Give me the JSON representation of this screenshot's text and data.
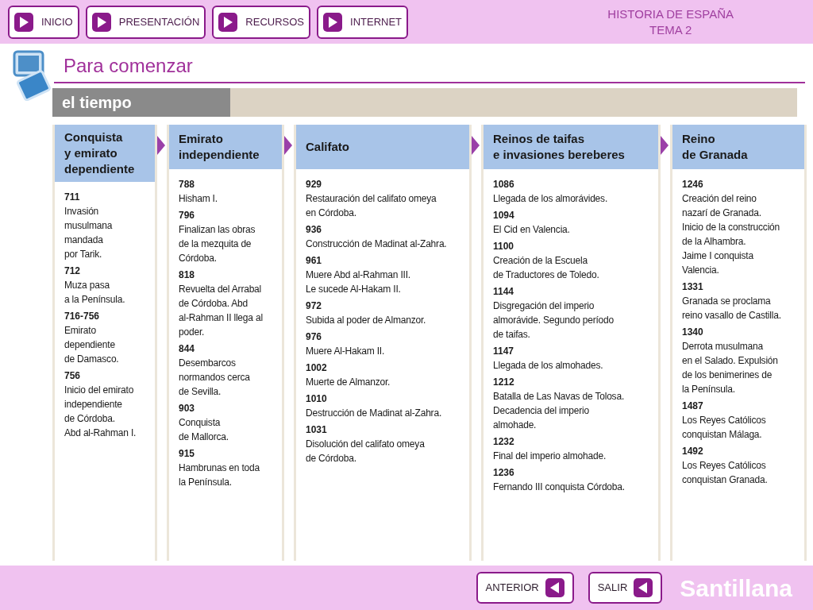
{
  "nav": [
    {
      "label": "INICIO"
    },
    {
      "label": "PRESENTACIÓN"
    },
    {
      "label": "RECURSOS"
    },
    {
      "label": "INTERNET"
    }
  ],
  "course": {
    "subject": "HISTORIA DE ESPAÑA",
    "unit": "TEMA 2"
  },
  "title": "Para comenzar",
  "section": "el tiempo",
  "columns": [
    {
      "title": "Conquista\ny emirato\ndependiente",
      "entries": [
        {
          "year": "711",
          "text": "Invasión\nmusulmana\nmandada\npor Tarik."
        },
        {
          "year": "712",
          "text": "Muza pasa\na la Península."
        },
        {
          "year": "716-756",
          "text": "Emirato\ndependiente\nde Damasco."
        },
        {
          "year": "756",
          "text": "Inicio del emirato\nindependiente\nde Córdoba.\nAbd al-Rahman I."
        }
      ]
    },
    {
      "title": "Emirato\nindependiente",
      "entries": [
        {
          "year": "788",
          "text": "Hisham I."
        },
        {
          "year": "796",
          "text": "Finalizan las obras\nde la mezquita de\nCórdoba."
        },
        {
          "year": "818",
          "text": "Revuelta del Arrabal\nde Córdoba. Abd\nal-Rahman II llega al\npoder."
        },
        {
          "year": "844",
          "text": "Desembarcos\nnormandos cerca\nde Sevilla."
        },
        {
          "year": "903",
          "text": "Conquista\nde Mallorca."
        },
        {
          "year": "915",
          "text": "Hambrunas en toda\nla Península."
        }
      ]
    },
    {
      "title": "Califato",
      "entries": [
        {
          "year": "929",
          "text": "Restauración del califato omeya\nen Córdoba."
        },
        {
          "year": "936",
          "text": "Construcción de Madinat al-Zahra."
        },
        {
          "year": "961",
          "text": "Muere Abd al-Rahman III.\nLe sucede Al-Hakam II."
        },
        {
          "year": "972",
          "text": "Subida al poder de Almanzor."
        },
        {
          "year": "976",
          "text": "Muere Al-Hakam II."
        },
        {
          "year": "1002",
          "text": "Muerte de Almanzor."
        },
        {
          "year": "1010",
          "text": "Destrucción de Madinat al-Zahra."
        },
        {
          "year": "1031",
          "text": "Disolución del califato omeya\nde Córdoba."
        }
      ]
    },
    {
      "title": "Reinos de taifas\ne invasiones bereberes",
      "entries": [
        {
          "year": "1086",
          "text": "Llegada de los almorávides."
        },
        {
          "year": "1094",
          "text": "El Cid en Valencia."
        },
        {
          "year": "1100",
          "text": "Creación de la Escuela\nde Traductores de Toledo."
        },
        {
          "year": "1144",
          "text": "Disgregación del imperio\nalmorávide. Segundo período\nde taifas."
        },
        {
          "year": "1147",
          "text": "Llegada de los almohades."
        },
        {
          "year": "1212",
          "text": "Batalla de Las Navas de Tolosa.\nDecadencia del imperio\nalmohade."
        },
        {
          "year": "1232",
          "text": "Final del imperio almohade."
        },
        {
          "year": "1236",
          "text": "Fernando III conquista Córdoba."
        }
      ]
    },
    {
      "title": "Reino\nde Granada",
      "entries": [
        {
          "year": "1246",
          "text": "Creación del reino\nnazarí de Granada.\nInicio de la construcción\nde la Alhambra.\nJaime I conquista\nValencia."
        },
        {
          "year": "1331",
          "text": "Granada se proclama\nreino vasallo de Castilla."
        },
        {
          "year": "1340",
          "text": "Derrota musulmana\nen el Salado. Expulsión\nde los benimerines de\nla Península."
        },
        {
          "year": "1487",
          "text": "Los Reyes Católicos\nconquistan Málaga."
        },
        {
          "year": "1492",
          "text": "Los Reyes Católicos\nconquistan Granada."
        }
      ]
    }
  ],
  "footer": {
    "buttons": [
      {
        "label": "ANTERIOR"
      },
      {
        "label": "SALIR"
      }
    ],
    "brand": "Santillana"
  }
}
